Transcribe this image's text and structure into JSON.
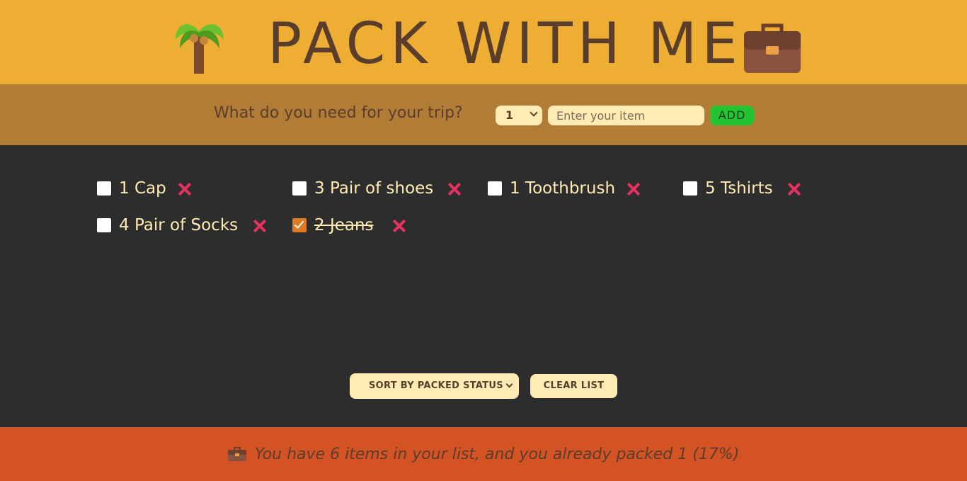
{
  "header": {
    "title": "PACK WITH ME",
    "left_icon": "palm-tree-icon",
    "right_icon": "suitcase-icon"
  },
  "form": {
    "question": "What do you need for your trip?",
    "quantity_selected": "1",
    "item_placeholder": "Enter your item",
    "item_value": "",
    "add_label": "ADD"
  },
  "items": [
    {
      "label": "1 Cap",
      "packed": false
    },
    {
      "label": "3 Pair of shoes",
      "packed": false
    },
    {
      "label": "1 Toothbrush",
      "packed": false
    },
    {
      "label": "5 Tshirts",
      "packed": false
    },
    {
      "label": "4 Pair of Socks",
      "packed": false
    },
    {
      "label": "2 Jeans",
      "packed": true
    }
  ],
  "actions": {
    "sort_selected": "SORT BY PACKED STATUS",
    "clear_label": "CLEAR LIST"
  },
  "stats": {
    "text": "You have 6 items in your list, and you already packed 1 (17%)",
    "icon": "briefcase-icon"
  },
  "colors": {
    "header_bg": "#edae33",
    "form_bg": "#b07c36",
    "list_bg": "#2d2d2d",
    "footer_bg": "#d45325",
    "text_dark": "#5a3e2b",
    "text_light": "#ffebb3",
    "add_button": "#22c432",
    "delete_x": "#e5325e",
    "checkbox_checked": "#e07a20"
  }
}
